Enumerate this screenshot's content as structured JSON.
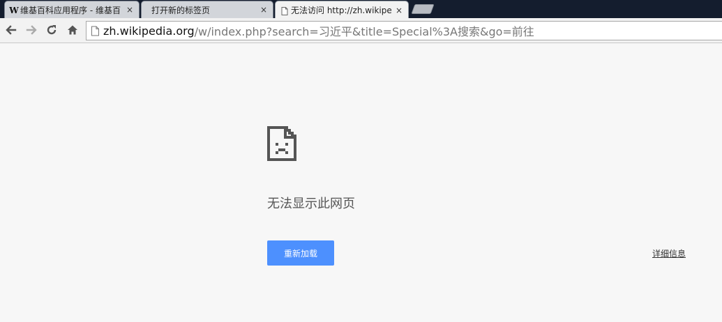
{
  "tabs": [
    {
      "title": "维基百科应用程序 - 维基百",
      "favicon": "wikipedia-w-icon",
      "close": "×"
    },
    {
      "title": "打开新的标签页",
      "close": "×"
    },
    {
      "title": "无法访问 http://zh.wikipe",
      "favicon": "blank-page-icon",
      "close": "×"
    }
  ],
  "favicon_letter": "W",
  "toolbar": {
    "back_icon": "back-arrow-icon",
    "forward_icon": "forward-arrow-icon",
    "reload_icon": "reload-icon",
    "home_icon": "home-icon"
  },
  "omnibox": {
    "url_host": "zh.wikipedia.org",
    "url_rest": "/w/index.php?search=习近平&title=Special%3A搜索&go=前往"
  },
  "error": {
    "icon": "sad-page-icon",
    "heading": "无法显示此网页",
    "reload_label": "重新加载",
    "details_label": "详细信息"
  },
  "colors": {
    "tabstrip": "#141d2e",
    "reload_button": "#4d90fe",
    "page_background": "#f7f7f7"
  }
}
